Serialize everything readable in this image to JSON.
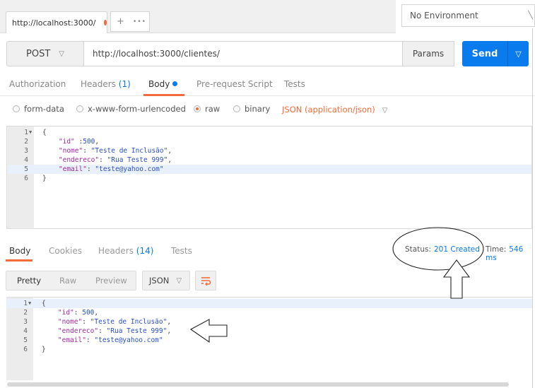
{
  "tab": {
    "title": "http://localhost:3000/",
    "new_tab": "+",
    "more": "•••"
  },
  "environment": {
    "selected": "No Environment"
  },
  "request": {
    "method": "POST",
    "url": "http://localhost:3000/clientes/",
    "params_label": "Params",
    "send_label": "Send"
  },
  "request_tabs": [
    {
      "label": "Authorization"
    },
    {
      "label": "Headers",
      "count": "(1)"
    },
    {
      "label": "Body"
    },
    {
      "label": "Pre-request Script"
    },
    {
      "label": "Tests"
    }
  ],
  "body_types": [
    {
      "label": "form-data",
      "selected": false
    },
    {
      "label": "x-www-form-urlencoded",
      "selected": false
    },
    {
      "label": "raw",
      "selected": true
    },
    {
      "label": "binary",
      "selected": false
    }
  ],
  "raw_type": "JSON (application/json)",
  "request_body": [
    {
      "n": "1",
      "text": "{"
    },
    {
      "n": "2",
      "key": "\"id\"",
      "sep": " :",
      "val": "500",
      "end": ","
    },
    {
      "n": "3",
      "key": "\"nome\"",
      "sep": ": ",
      "val": "\"Teste de Inclusão\"",
      "end": ","
    },
    {
      "n": "4",
      "key": "\"endereco\"",
      "sep": ": ",
      "val": "\"Rua Teste 999\"",
      "end": ","
    },
    {
      "n": "5",
      "key": "\"email\"",
      "sep": ": ",
      "val": "\"teste@yahoo.com\"",
      "end": ""
    },
    {
      "n": "6",
      "text": "}"
    }
  ],
  "response_tabs": [
    {
      "label": "Body"
    },
    {
      "label": "Cookies"
    },
    {
      "label": "Headers",
      "count": "(14)"
    },
    {
      "label": "Tests"
    }
  ],
  "status": {
    "label": "Status:",
    "value": "201 Created"
  },
  "time": {
    "label": "Time:",
    "value": "546 ms"
  },
  "view_modes": [
    "Pretty",
    "Raw",
    "Preview"
  ],
  "response_format": "JSON",
  "response_body": [
    {
      "n": "1",
      "text": "{"
    },
    {
      "n": "2",
      "key": "\"id\"",
      "sep": ": ",
      "val": "500",
      "end": ","
    },
    {
      "n": "3",
      "key": "\"nome\"",
      "sep": ": ",
      "val": "\"Teste de Inclusão\"",
      "end": ","
    },
    {
      "n": "4",
      "key": "\"endereco\"",
      "sep": ": ",
      "val": "\"Rua Teste 999\"",
      "end": ","
    },
    {
      "n": "5",
      "key": "\"email\"",
      "sep": ": ",
      "val": "\"teste@yahoo.com\"",
      "end": ""
    },
    {
      "n": "6",
      "text": "}"
    }
  ],
  "colors": {
    "accent": "#f26b3a",
    "send": "#097bed",
    "link": "#097bed"
  }
}
